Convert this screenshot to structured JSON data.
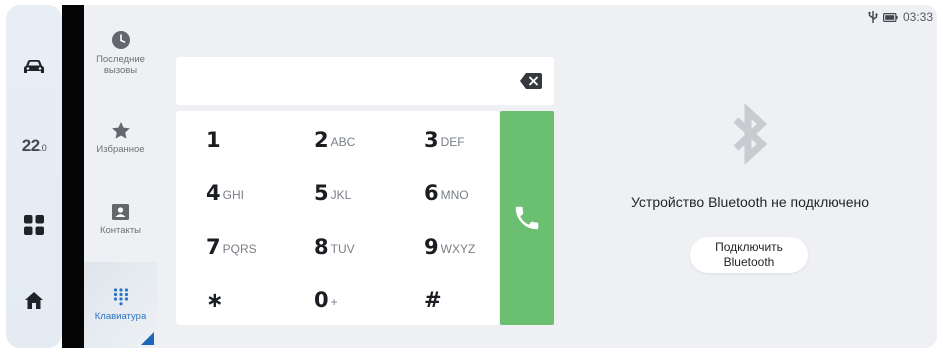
{
  "status_bar": {
    "time": "03:33"
  },
  "rail": {
    "temperature": "22",
    "temperature_unit": ".0"
  },
  "nav": {
    "recent": "Последние вызовы",
    "favorites": "Избранное",
    "contacts": "Контакты",
    "keypad": "Клавиатура"
  },
  "dialer": {
    "input_value": "",
    "keys": [
      {
        "digit": "1",
        "letters": ""
      },
      {
        "digit": "2",
        "letters": "ABC"
      },
      {
        "digit": "3",
        "letters": "DEF"
      },
      {
        "digit": "4",
        "letters": "GHI"
      },
      {
        "digit": "5",
        "letters": "JKL"
      },
      {
        "digit": "6",
        "letters": "MNO"
      },
      {
        "digit": "7",
        "letters": "PQRS"
      },
      {
        "digit": "8",
        "letters": "TUV"
      },
      {
        "digit": "9",
        "letters": "WXYZ"
      },
      {
        "digit": "∗",
        "letters": ""
      },
      {
        "digit": "0",
        "letters": "+"
      },
      {
        "digit": "#",
        "letters": ""
      }
    ]
  },
  "bluetooth": {
    "message": "Устройство Bluetooth не подключено",
    "connect_line1": "Подключить",
    "connect_line2": "Bluetooth"
  },
  "colors": {
    "call_green": "#6bbf71",
    "accent_blue": "#2a73c6"
  }
}
